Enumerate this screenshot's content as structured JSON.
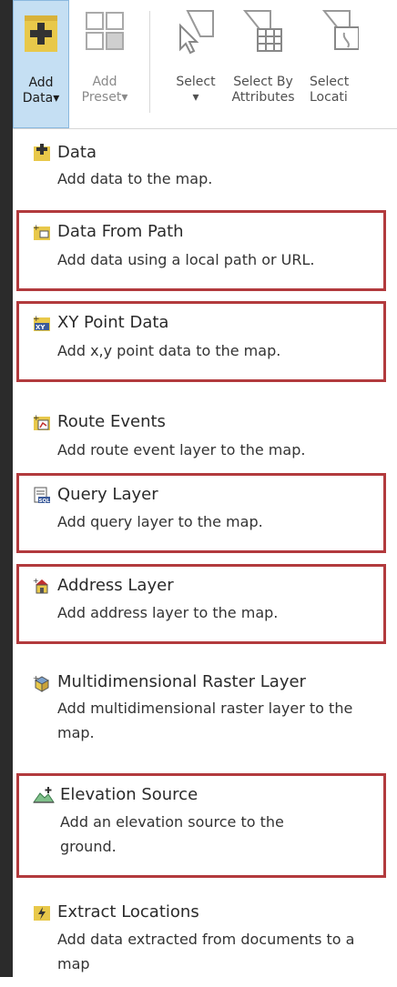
{
  "ribbon": {
    "add_data": {
      "line1": "Add",
      "line2": "Data",
      "caret": "▾"
    },
    "add_preset": {
      "line1": "Add",
      "line2": "Preset",
      "caret": "▾"
    },
    "select": {
      "line1": "Select",
      "line2": "",
      "caret": "▾"
    },
    "select_by_attributes": {
      "line1": "Select By",
      "line2": "Attributes"
    },
    "select_by_location": {
      "line1": "Select",
      "line2": "Locati"
    }
  },
  "menu": {
    "items": [
      {
        "title": "Data",
        "desc": "Add data to the map.",
        "icon": "add-data-icon",
        "highlighted": false
      },
      {
        "title": "Data From Path",
        "desc": "Add data using a local path or URL.",
        "icon": "data-from-path-icon",
        "highlighted": true
      },
      {
        "title": "XY Point Data",
        "desc": "Add x,y point data to the map.",
        "icon": "xy-point-data-icon",
        "highlighted": true
      },
      {
        "title": "Route Events",
        "desc": "Add route event layer to the map.",
        "icon": "route-events-icon",
        "highlighted": false
      },
      {
        "title": "Query Layer",
        "desc": "Add query layer to the map.",
        "icon": "query-layer-icon",
        "highlighted": true
      },
      {
        "title": "Address Layer",
        "desc": "Add address layer to the map.",
        "icon": "address-layer-icon",
        "highlighted": true
      },
      {
        "title": "Multidimensional Raster Layer",
        "desc": "Add multidimensional raster layer to the map.",
        "icon": "multidimensional-raster-icon",
        "highlighted": false
      },
      {
        "title": "Elevation Source",
        "desc": "Add an elevation source to the ground.",
        "icon": "elevation-source-icon",
        "highlighted": true
      },
      {
        "title": "Extract Locations",
        "desc": "Add data extracted from documents to a map",
        "icon": "extract-locations-icon",
        "highlighted": false
      }
    ]
  },
  "colors": {
    "highlight_border": "#b23a3d",
    "active_button": "#c5dff3",
    "folder_yellow": "#e8c84a"
  }
}
